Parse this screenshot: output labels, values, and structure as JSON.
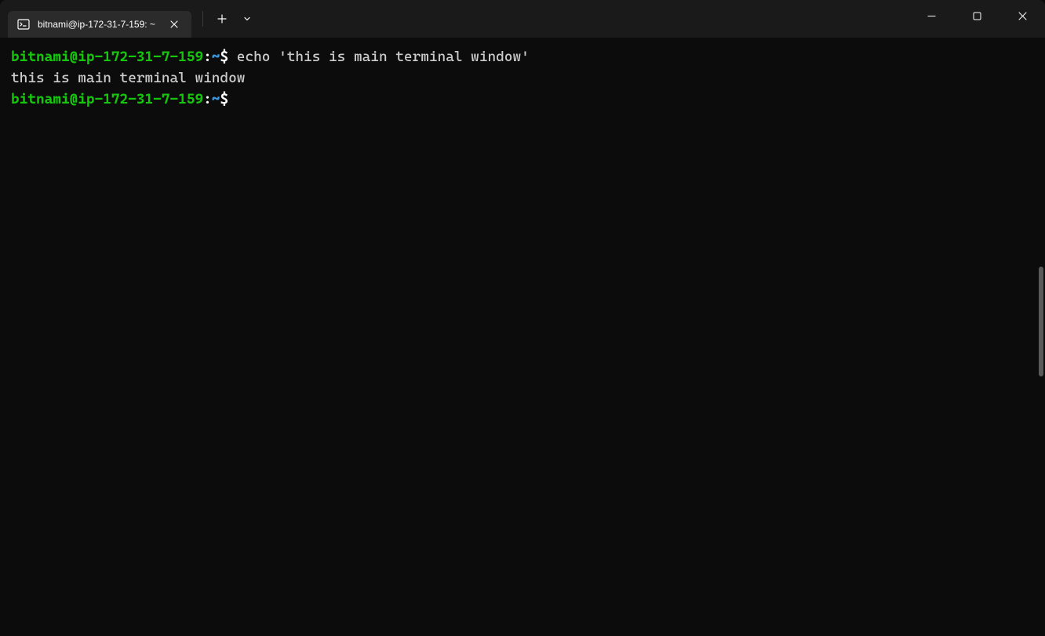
{
  "titlebar": {
    "tab_title": "bitnami@ip-172-31-7-159: ~"
  },
  "terminal": {
    "lines": [
      {
        "user": "bitnami@ip-172-31-7-159",
        "colon": ":",
        "path": "~",
        "dollar": "$",
        "command": " echo 'this is main terminal window'"
      }
    ],
    "output": "this is main terminal window",
    "prompt2": {
      "user": "bitnami@ip-172-31-7-159",
      "colon": ":",
      "path": "~",
      "dollar": "$",
      "command": " "
    }
  }
}
